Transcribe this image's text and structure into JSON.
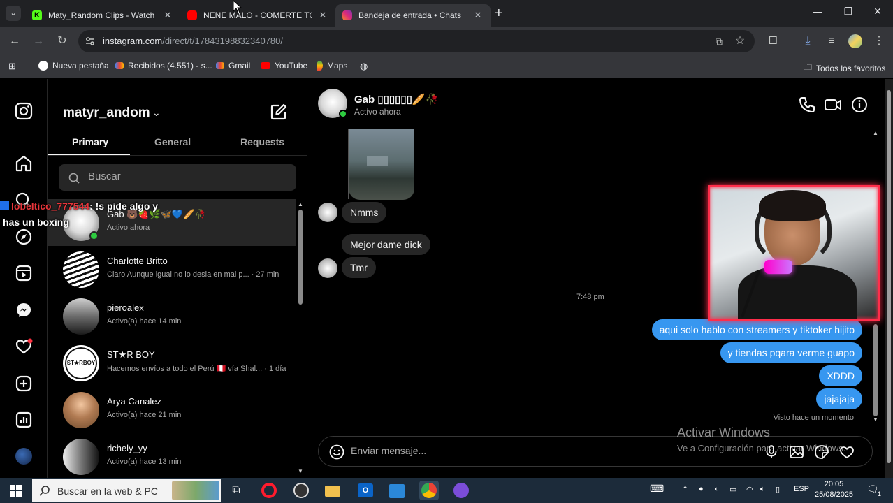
{
  "browser": {
    "tabs": [
      {
        "title": "Maty_Random Clips - Watch Li",
        "color": "#53fc18"
      },
      {
        "title": "NENE MALO - COMERTE TODA",
        "color": "#ff0000"
      },
      {
        "title": "Bandeja de entrada • Chats",
        "color": "#e1306c"
      }
    ],
    "new_tab": "+",
    "url_host": "instagram.com",
    "url_path": "/direct/t/17843198832340780/",
    "bookmarks": [
      {
        "label": "Nueva pestaña"
      },
      {
        "label": "Recibidos (4.551) - s..."
      },
      {
        "label": "Gmail"
      },
      {
        "label": "YouTube"
      },
      {
        "label": "Maps"
      }
    ],
    "all_bookmarks": "Todos los favoritos"
  },
  "inbox": {
    "account": "matyr_andom",
    "tabs": [
      "Primary",
      "General",
      "Requests"
    ],
    "search_placeholder": "Buscar",
    "conversations": [
      {
        "name": "Gab 🐻🍓🌿🦋💙🥖🥀",
        "sub": "Activo ahora",
        "online": true
      },
      {
        "name": "Charlotte Britto",
        "sub": "Claro Aunque igual no lo desia en mal p... · 27 min",
        "online": false
      },
      {
        "name": "pieroalex",
        "sub": "Activo(a) hace 14 min",
        "online": false
      },
      {
        "name": "ST★R BOY",
        "sub": "Hacemos envíos a todo el Perú 🇵🇪 vía Shal... · 1 día",
        "online": false
      },
      {
        "name": "Arya Canalez",
        "sub": "Activo(a) hace 21 min",
        "online": false
      },
      {
        "name": "richely_yy",
        "sub": "Activo(a) hace 13 min",
        "online": false
      }
    ]
  },
  "overlay": {
    "user": "lobeltico_777544",
    "message_line1": ": !s pide algo y",
    "message_line2": "has un boxing"
  },
  "chat": {
    "name": "Gab ▯▯▯▯▯▯🥖🥀",
    "status": "Activo ahora",
    "incoming": [
      "Nmms",
      "Mejor dame dick",
      "Tmr"
    ],
    "timestamp": "7:48 pm",
    "outgoing": [
      "aqui solo hablo con streamers y tiktoker hijito",
      "y tiendas pqara verme guapo",
      "XDDD",
      "jajajaja"
    ],
    "seen": "Visto hace un momento",
    "composer_placeholder": "Enviar mensaje..."
  },
  "watermark": {
    "line1": "Activar Windows",
    "line2": "Ve a Configuración para activar Windows."
  },
  "taskbar": {
    "search_placeholder": "Buscar en la web & PC",
    "lang": "ESP",
    "time": "20:05",
    "date": "25/08/2025",
    "notif_count": "1"
  },
  "colors": {
    "accent_blue": "#3797f0",
    "online_green": "#2ecc40",
    "cam_border": "#ff2d4a"
  }
}
